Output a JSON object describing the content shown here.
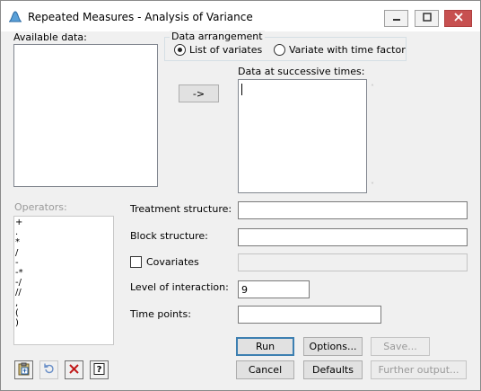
{
  "window": {
    "title": "Repeated Measures - Analysis of Variance",
    "icon": "chart-icon",
    "controls": [
      "minimize-icon",
      "maximize-icon",
      "close-icon"
    ]
  },
  "available_data": {
    "label": "Available data:"
  },
  "data_arrangement": {
    "label": "Data arrangement",
    "options": [
      "List of variates",
      "Variate with time factor"
    ],
    "selected": "List of variates"
  },
  "transfer_button": {
    "label": "->"
  },
  "successive_times": {
    "label": "Data at successive times:"
  },
  "operators": {
    "label": "Operators:",
    "items": [
      "+",
      ".",
      "*",
      "/",
      "-",
      "-*",
      "-/",
      "//",
      ",",
      "(",
      ")"
    ]
  },
  "fields": {
    "treatment_structure": {
      "label": "Treatment structure:",
      "value": ""
    },
    "block_structure": {
      "label": "Block structure:",
      "value": ""
    },
    "covariates": {
      "label": "Covariates",
      "checked": false,
      "value": ""
    },
    "level_of_interaction": {
      "label": "Level of interaction:",
      "value": "9"
    },
    "time_points": {
      "label": "Time points:",
      "value": ""
    }
  },
  "buttons": {
    "run": "Run",
    "options": "Options...",
    "save": "Save...",
    "cancel": "Cancel",
    "defaults": "Defaults",
    "further_output": "Further output..."
  },
  "toolbar": [
    "clipboard-icon",
    "undo-icon",
    "clear-icon",
    "help-icon"
  ]
}
